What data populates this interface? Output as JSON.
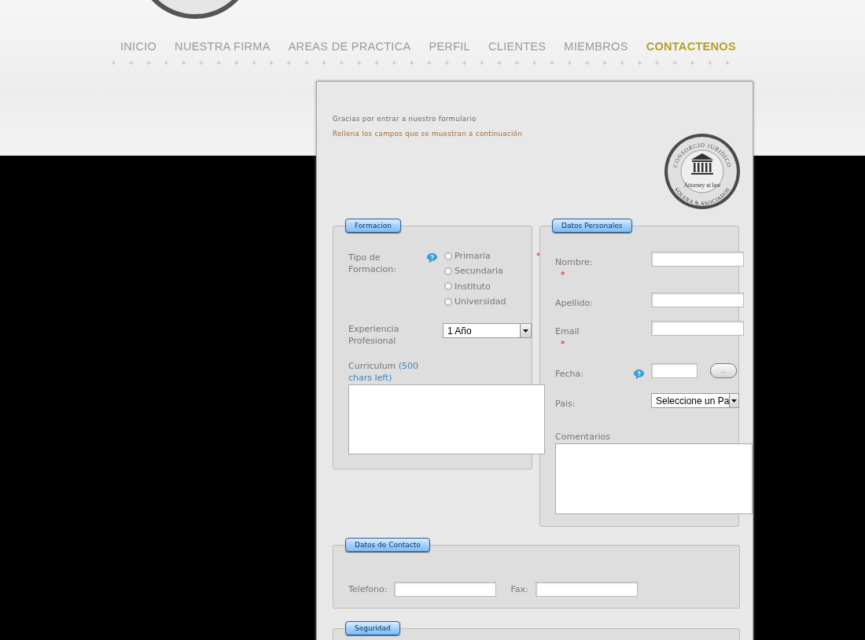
{
  "nav": [
    {
      "label": "INICIO",
      "selected": false
    },
    {
      "label": "NUESTRA FIRMA",
      "selected": false
    },
    {
      "label": "AREAS DE PRACTICA",
      "selected": false
    },
    {
      "label": "PERFIL",
      "selected": false
    },
    {
      "label": "CLIENTES",
      "selected": false
    },
    {
      "label": "MIEMBROS",
      "selected": false
    },
    {
      "label": "CONTACTENOS",
      "selected": true
    }
  ],
  "required_mark": "*",
  "intro": [
    "Gracias por entrar a nuestro formulario",
    "Rellena los campos que se muestran a continuación"
  ],
  "logo": {
    "arc_top": "CONSORCIO JURIDICO",
    "tagline": "Attorney at law",
    "arc_bottom": "SOLERA & ASOCIADOS"
  },
  "formacion": {
    "legend": "Formacion",
    "tipo_label": "Tipo de Formacion:",
    "required": true,
    "options": [
      {
        "label": "Primaria",
        "selected": false
      },
      {
        "label": "Secundaria",
        "selected": false
      },
      {
        "label": "Instituto",
        "selected": false
      },
      {
        "label": "Universidad",
        "selected": false
      }
    ],
    "experiencia_label": "Experiencia Profesional",
    "experiencia_value": "1 Año",
    "curriculum_label": "Curriculum",
    "chars_left": "(500 chars left)"
  },
  "personal": {
    "legend": "Datos Personales",
    "comments_label": "Comentarios",
    "fields": [
      {
        "kind": "text",
        "label": "Nombre:",
        "required": true
      },
      {
        "kind": "text",
        "label": "Apellido:",
        "required": false
      },
      {
        "kind": "text",
        "label": "Email",
        "required": true
      },
      {
        "kind": "date",
        "label": "Fecha:",
        "required": false,
        "button": "..."
      },
      {
        "kind": "select",
        "label": "Pais:",
        "required": false,
        "value": "Seleccione un Pa"
      }
    ]
  },
  "contacto": {
    "legend": "Datos de Contacto",
    "fields": [
      {
        "label": "Telefono:"
      },
      {
        "label": "Fax:"
      }
    ]
  },
  "seguridad": {
    "legend": "Seguridad"
  }
}
